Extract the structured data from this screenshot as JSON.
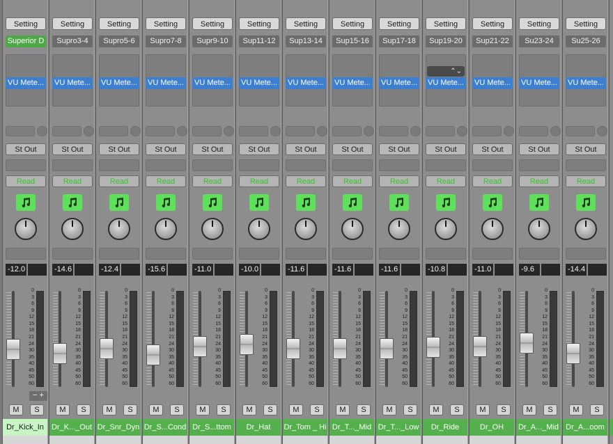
{
  "window": {
    "title": ""
  },
  "scale_marks": [
    "0",
    "3",
    "6",
    "9",
    "12",
    "15",
    "18",
    "21",
    "24",
    "30",
    "35",
    "40",
    "45",
    "50",
    "60"
  ],
  "width_control_label": "− +",
  "channels": [
    {
      "setting": "Setting",
      "eq": "Superior D",
      "eq_active": true,
      "plugin": "VU Mete...",
      "output": "St Out",
      "automation": "Read",
      "volume": "-12.0",
      "fader_level": 0.36,
      "mute": "M",
      "solo": "S",
      "name": "Dr_Kick_In",
      "selected": true,
      "width_control": true,
      "select_popup": false
    },
    {
      "setting": "Setting",
      "eq": "Supro3-4",
      "eq_active": false,
      "plugin": "VU Mete...",
      "output": "St Out",
      "automation": "Read",
      "volume": "-14.6",
      "fader_level": 0.31,
      "mute": "M",
      "solo": "S",
      "name": "Dr_K..._Out",
      "selected": false,
      "width_control": false,
      "select_popup": false
    },
    {
      "setting": "Setting",
      "eq": "Supro5-6",
      "eq_active": false,
      "plugin": "VU Mete...",
      "output": "St Out",
      "automation": "Read",
      "volume": "-12.4",
      "fader_level": 0.37,
      "mute": "M",
      "solo": "S",
      "name": "Dr_Snr_Dyn",
      "selected": false,
      "width_control": false,
      "select_popup": false
    },
    {
      "setting": "Setting",
      "eq": "Supro7-8",
      "eq_active": false,
      "plugin": "VU Mete...",
      "output": "St Out",
      "automation": "Read",
      "volume": "-15.6",
      "fader_level": 0.29,
      "mute": "M",
      "solo": "S",
      "name": "Dr_S...Cond",
      "selected": false,
      "width_control": false,
      "select_popup": false
    },
    {
      "setting": "Setting",
      "eq": "Supr9-10",
      "eq_active": false,
      "plugin": "VU Mete...",
      "output": "St Out",
      "automation": "Read",
      "volume": "-11.0",
      "fader_level": 0.4,
      "mute": "M",
      "solo": "S",
      "name": "Dr_S...ttom",
      "selected": false,
      "width_control": false,
      "select_popup": false
    },
    {
      "setting": "Setting",
      "eq": "Sup11-12",
      "eq_active": false,
      "plugin": "VU Mete...",
      "output": "St Out",
      "automation": "Read",
      "volume": "-10.0",
      "fader_level": 0.43,
      "mute": "M",
      "solo": "S",
      "name": "Dr_Hat",
      "selected": false,
      "width_control": false,
      "select_popup": false
    },
    {
      "setting": "Setting",
      "eq": "Sup13-14",
      "eq_active": false,
      "plugin": "VU Mete...",
      "output": "St Out",
      "automation": "Read",
      "volume": "-11.6",
      "fader_level": 0.37,
      "mute": "M",
      "solo": "S",
      "name": "Dr_Tom _ Hi",
      "selected": false,
      "width_control": false,
      "select_popup": false
    },
    {
      "setting": "Setting",
      "eq": "Sup15-16",
      "eq_active": false,
      "plugin": "VU Mete...",
      "output": "St Out",
      "automation": "Read",
      "volume": "-11.6",
      "fader_level": 0.37,
      "mute": "M",
      "solo": "S",
      "name": "Dr_T..._Mid",
      "selected": false,
      "width_control": false,
      "select_popup": false
    },
    {
      "setting": "Setting",
      "eq": "Sup17-18",
      "eq_active": false,
      "plugin": "VU Mete...",
      "output": "St Out",
      "automation": "Read",
      "volume": "-11.6",
      "fader_level": 0.37,
      "mute": "M",
      "solo": "S",
      "name": "Dr_T..._Low",
      "selected": false,
      "width_control": false,
      "select_popup": false
    },
    {
      "setting": "Setting",
      "eq": "Sup19-20",
      "eq_active": false,
      "plugin": "VU Mete...",
      "output": "St Out",
      "automation": "Read",
      "volume": "-10.8",
      "fader_level": 0.39,
      "mute": "M",
      "solo": "S",
      "name": "Dr_Ride",
      "selected": false,
      "width_control": false,
      "select_popup": true
    },
    {
      "setting": "Setting",
      "eq": "Sup21-22",
      "eq_active": false,
      "plugin": "VU Mete...",
      "output": "St Out",
      "automation": "Read",
      "volume": "-11.0",
      "fader_level": 0.4,
      "mute": "M",
      "solo": "S",
      "name": "Dr_OH",
      "selected": false,
      "width_control": false,
      "select_popup": false
    },
    {
      "setting": "Setting",
      "eq": "Su23-24",
      "eq_active": false,
      "plugin": "VU Mete...",
      "output": "St Out",
      "automation": "Read",
      "volume": "-9.6",
      "fader_level": 0.44,
      "mute": "M",
      "solo": "S",
      "name": "Dr_A..._Mid",
      "selected": false,
      "width_control": false,
      "select_popup": false
    },
    {
      "setting": "Setting",
      "eq": "Su25-26",
      "eq_active": false,
      "plugin": "VU Mete...",
      "output": "St Out",
      "automation": "Read",
      "volume": "-14.4",
      "fader_level": 0.31,
      "mute": "M",
      "solo": "S",
      "name": "Dr_A...oom",
      "selected": false,
      "width_control": false,
      "select_popup": false
    }
  ],
  "icons": {
    "track_icon": "music-note-icon",
    "pan": "pan-knob",
    "popup": "updown-chevron-icon"
  },
  "colors": {
    "strip_background": "#8d8d8d",
    "eq_active": "#4ea846",
    "plugin_slot": "#3c7fd1",
    "automation_text": "#35c42a",
    "track_icon": "#5fe05a",
    "name_tab": "#54b04c",
    "name_tab_selected": "#c8f5c4"
  }
}
